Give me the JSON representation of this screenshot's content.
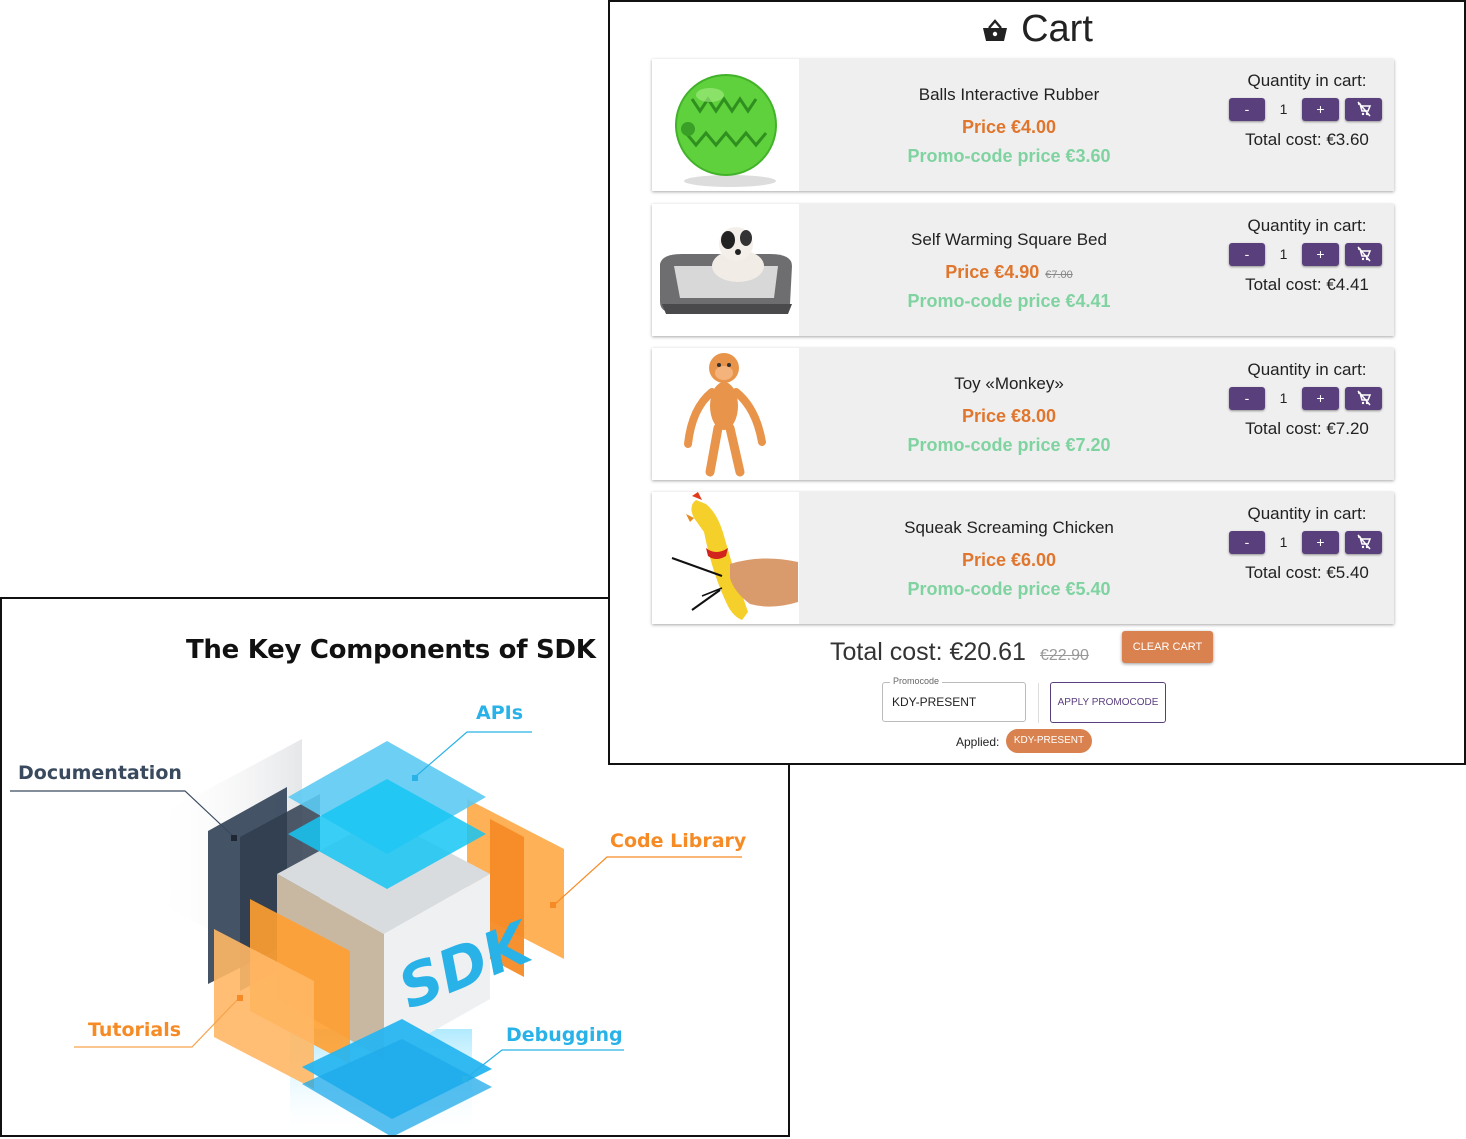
{
  "sdk": {
    "title": "The Key Components of SDK",
    "cube_text": "SDK",
    "labels": {
      "apis": "APIs",
      "documentation": "Documentation",
      "code_library": "Code Library",
      "tutorials": "Tutorials",
      "debugging": "Debugging"
    },
    "colors": {
      "blue": "#29b2e8",
      "orange": "#f68b26",
      "dark": "#3a4a5e"
    }
  },
  "cart": {
    "title": "Cart",
    "header_icon": "basket-icon",
    "quantity_label": "Quantity in cart:",
    "minus_label": "-",
    "plus_label": "+",
    "remove_icon": "remove-from-cart-icon",
    "items": [
      {
        "name": "Balls Interactive Rubber",
        "price": "Price  €4.00",
        "old_price": "",
        "promo": "Promo-code price €3.60",
        "quantity": "1",
        "total": "Total cost: €3.60",
        "image": "green-ball-image"
      },
      {
        "name": "Self Warming Square Bed",
        "price": "Price €4.90",
        "old_price": "€7.00",
        "promo": "Promo-code price €4.41",
        "quantity": "1",
        "total": "Total cost: €4.41",
        "image": "dog-bed-image"
      },
      {
        "name": "Toy «Monkey»",
        "price": "Price  €8.00",
        "old_price": "",
        "promo": "Promo-code price €7.20",
        "quantity": "1",
        "total": "Total cost: €7.20",
        "image": "monkey-toy-image"
      },
      {
        "name": "Squeak Screaming Chicken",
        "price": "Price  €6.00",
        "old_price": "",
        "promo": "Promo-code price €5.40",
        "quantity": "1",
        "total": "Total cost: €5.40",
        "image": "rubber-chicken-image"
      }
    ],
    "grand_total": "Total cost: €20.61",
    "grand_total_old": "€22.90",
    "clear_button": "CLEAR CART",
    "promocode": {
      "legend": "Promocode",
      "value": "KDY-PRESENT",
      "apply_button": "APPLY PROMOCODE",
      "applied_label": "Applied:",
      "applied_chip": "KDY-PRESENT"
    },
    "colors": {
      "button": "#5a3f7d",
      "price": "#e0762d",
      "promo": "#7fd3a0",
      "accent": "#d9824f"
    }
  }
}
